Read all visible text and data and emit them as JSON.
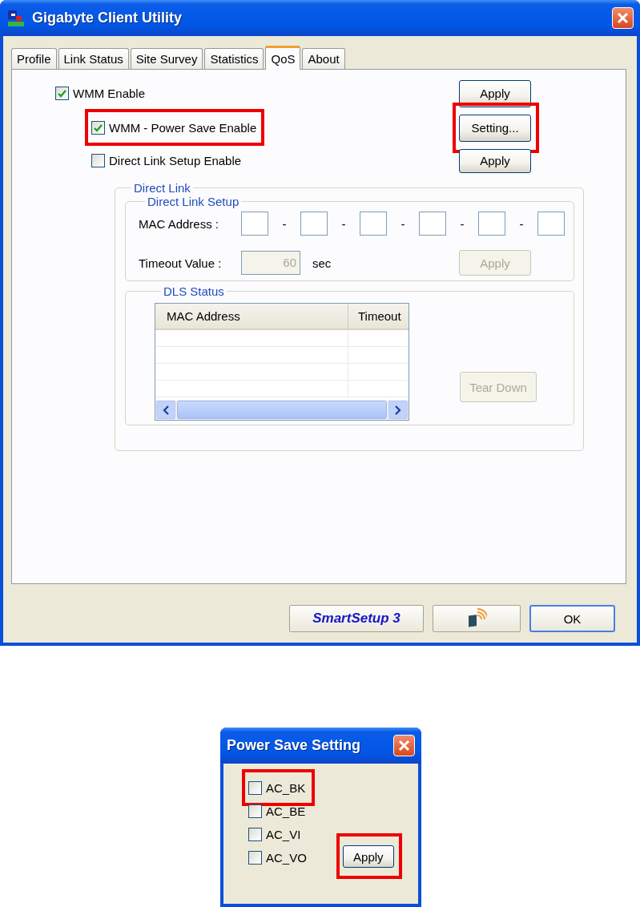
{
  "window": {
    "title": "Gigabyte Client Utility"
  },
  "tabs": [
    {
      "label": "Profile",
      "selected": false
    },
    {
      "label": "Link Status",
      "selected": false
    },
    {
      "label": "Site Survey",
      "selected": false
    },
    {
      "label": "Statistics",
      "selected": false
    },
    {
      "label": "QoS",
      "selected": true
    },
    {
      "label": "About",
      "selected": false
    }
  ],
  "qos": {
    "options": [
      {
        "label": "WMM Enable",
        "checked": true,
        "highlighted": false
      },
      {
        "label": "WMM - Power Save Enable",
        "checked": true,
        "highlighted": true
      },
      {
        "label": "Direct Link Setup Enable",
        "checked": false,
        "highlighted": false
      }
    ],
    "buttons": [
      {
        "label": "Apply",
        "highlighted": false
      },
      {
        "label": "Setting...",
        "highlighted": true
      },
      {
        "label": "Apply",
        "highlighted": false
      }
    ]
  },
  "direct_link": {
    "title": "Direct Link",
    "setup": {
      "title": "Direct Link Setup",
      "mac_label": "MAC Address :",
      "mac_separators": [
        "-",
        "-",
        "-",
        "-",
        "-"
      ],
      "timeout_label": "Timeout Value :",
      "timeout_value": "60",
      "timeout_disabled": true,
      "unit": "sec",
      "apply": {
        "label": "Apply",
        "disabled": true
      }
    },
    "dls_status": {
      "title": "DLS Status",
      "columns": [
        "MAC Address",
        "Timeout"
      ],
      "tear_down": {
        "label": "Tear Down",
        "disabled": true
      }
    }
  },
  "footer_buttons": [
    {
      "kind": "brand",
      "label": "SmartSetup 3"
    },
    {
      "kind": "icon"
    },
    {
      "kind": "text",
      "label": "OK"
    }
  ],
  "popup": {
    "title": "Power Save Setting",
    "options": [
      {
        "label": "AC_BK",
        "checked": false,
        "highlighted": true
      },
      {
        "label": "AC_BE",
        "checked": false,
        "highlighted": false
      },
      {
        "label": "AC_VI",
        "checked": false,
        "highlighted": false
      },
      {
        "label": "AC_VO",
        "checked": false,
        "highlighted": false
      }
    ],
    "apply": {
      "label": "Apply",
      "highlighted": true
    }
  }
}
